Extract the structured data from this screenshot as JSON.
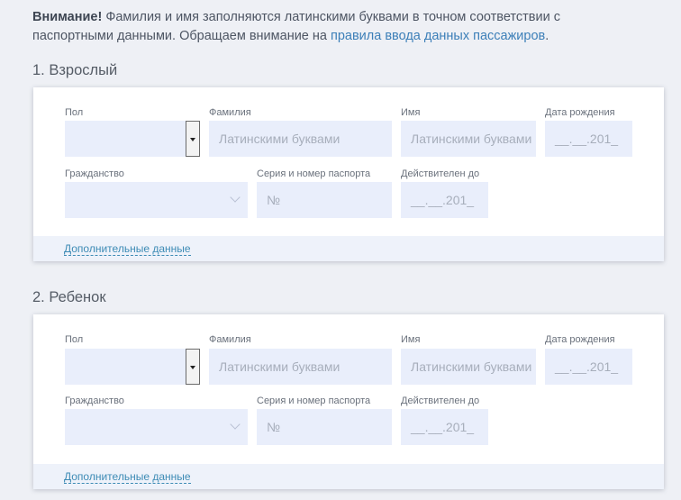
{
  "notice": {
    "bold": "Внимание!",
    "text": " Фамилия и имя заполняются латинскими буквами в точном соответствии с паспортными данными. Обращаем внимание на ",
    "link": "правила ввода данных пассажиров",
    "end": "."
  },
  "passengers": [
    {
      "title": "1. Взрослый",
      "labels": {
        "gender": "Пол",
        "surname": "Фамилия",
        "name": "Имя",
        "birth": "Дата рождения",
        "citizenship": "Гражданство",
        "passport": "Серия и номер паспорта",
        "valid": "Действителен до"
      },
      "placeholders": {
        "surname": "Латинскими буквами",
        "name": "Латинскими буквами",
        "birth": "__.__.201_",
        "passport": "№",
        "valid": "__.__.201_"
      },
      "more": "Дополнительные данные"
    },
    {
      "title": "2. Ребенок",
      "labels": {
        "gender": "Пол",
        "surname": "Фамилия",
        "name": "Имя",
        "birth": "Дата рождения",
        "citizenship": "Гражданство",
        "passport": "Серия и номер паспорта",
        "valid": "Действителен до"
      },
      "placeholders": {
        "surname": "Латинскими буквами",
        "name": "Латинскими буквами",
        "birth": "__.__.201_",
        "passport": "№",
        "valid": "__.__.201_"
      },
      "more": "Дополнительные данные"
    }
  ]
}
